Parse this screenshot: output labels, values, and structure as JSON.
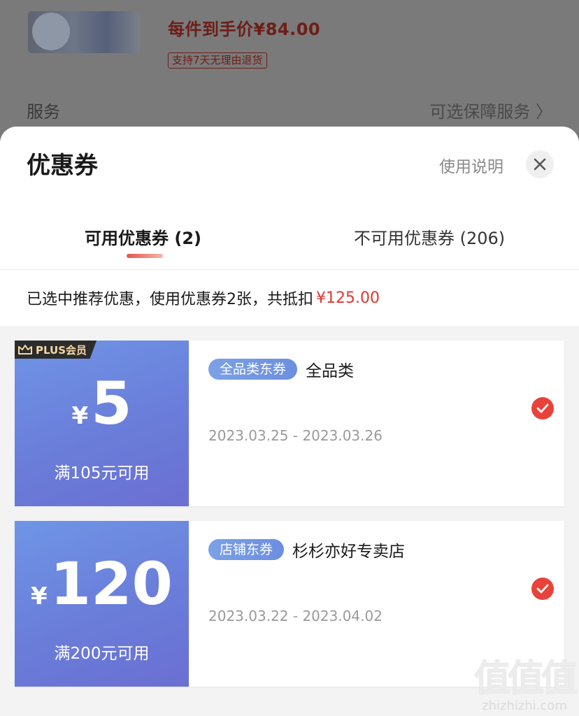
{
  "background": {
    "price_text": "每件到手价¥84.00",
    "return_policy": "支持7天无理由退货",
    "service_label": "服务",
    "service_value": "可选保障服务 〉"
  },
  "sheet": {
    "title": "优惠券",
    "usage_link": "使用说明",
    "close_icon": "close-icon"
  },
  "tabs": [
    {
      "label": "可用优惠券 (2)",
      "active": true
    },
    {
      "label": "不可用优惠券 (206)",
      "active": false
    }
  ],
  "summary": {
    "text": "已选中推荐优惠，使用优惠券2张，共抵扣",
    "amount": "¥125.00"
  },
  "coupons": [
    {
      "badge": "PLUS会员",
      "currency": "¥",
      "amount": "5",
      "condition": "满105元可用",
      "tag": "全品类东券",
      "name": "全品类",
      "date_range": "2023.03.25 - 2023.03.26",
      "selected": true
    },
    {
      "currency": "¥",
      "amount": "120",
      "condition": "满200元可用",
      "tag": "店铺东券",
      "name": "杉杉亦好专卖店",
      "date_range": "2023.03.22 - 2023.04.02",
      "selected": true
    }
  ],
  "colors": {
    "accent_red": "#e2362f",
    "coupon_blue": "#6a7dd9",
    "check_red": "#e8433a"
  },
  "watermark": {
    "logo": "值值值",
    "url": "zhizhizhi.com"
  }
}
